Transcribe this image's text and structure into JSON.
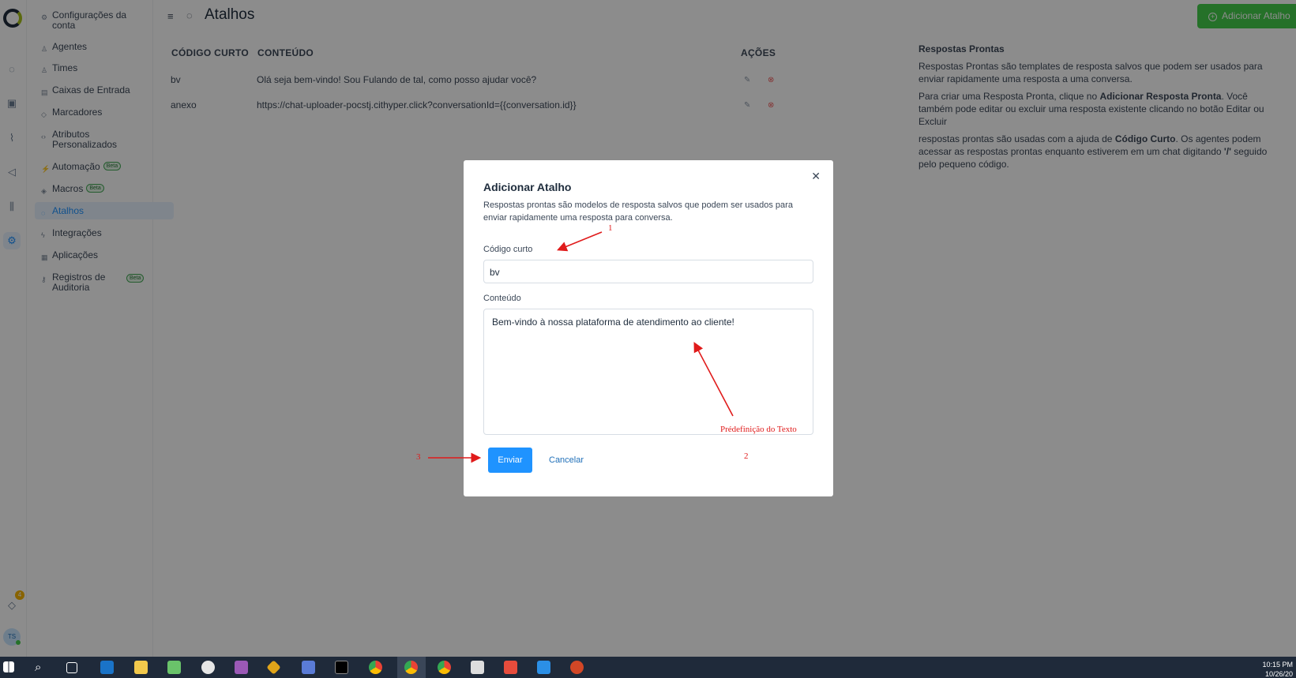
{
  "header": {
    "title": "Atalhos",
    "add_button": "Adicionar Atalho"
  },
  "sidebar": {
    "items": [
      {
        "label": "Configurações da conta",
        "icon": "gear-icon"
      },
      {
        "label": "Agentes",
        "icon": "people-icon"
      },
      {
        "label": "Times",
        "icon": "team-icon"
      },
      {
        "label": "Caixas de Entrada",
        "icon": "inbox-icon"
      },
      {
        "label": "Marcadores",
        "icon": "tag-icon"
      },
      {
        "label": "Atributos Personalizados",
        "icon": "code-icon"
      },
      {
        "label": "Automação",
        "icon": "automation-icon",
        "badge": "Beta"
      },
      {
        "label": "Macros",
        "icon": "macro-icon",
        "badge": "Beta"
      },
      {
        "label": "Atalhos",
        "icon": "chat-icon"
      },
      {
        "label": "Integrações",
        "icon": "plug-icon"
      },
      {
        "label": "Aplicações",
        "icon": "apps-icon"
      },
      {
        "label": "Registros de Auditoria",
        "icon": "key-icon",
        "badge": "Beta"
      }
    ]
  },
  "table": {
    "headers": [
      "CÓDIGO CURTO",
      "CONTEÚDO",
      "AÇÕES"
    ],
    "rows": [
      {
        "code": "bv",
        "content": "Olá seja bem-vindo! Sou Fulando de tal, como posso ajudar você?"
      },
      {
        "code": "anexo",
        "content": "https://chat-uploader-pocstj.cithyper.click?conversationId={{conversation.id}}"
      }
    ]
  },
  "info": {
    "title": "Respostas Prontas",
    "p1": "Respostas Prontas são templates de resposta salvos que podem ser usados para enviar rapidamente uma resposta a uma conversa.",
    "p2_a": "Para criar uma Resposta Pronta, clique no ",
    "p2_b": "Adicionar Resposta Pronta",
    "p2_c": ". Você também pode editar ou excluir uma resposta existente clicando no botão Editar ou Excluir",
    "p3_a": "respostas prontas são usadas com a ajuda de ",
    "p3_b": "Código Curto",
    "p3_c": ". Os agentes podem acessar as respostas prontas enquanto estiverem em um chat digitando ",
    "p3_d": "'/'",
    "p3_e": " seguido pelo pequeno código."
  },
  "modal": {
    "title": "Adicionar Atalho",
    "description": "Respostas prontas são modelos de resposta salvos que podem ser usados para enviar rapidamente uma resposta para conversa.",
    "code_label": "Código curto",
    "code_value": "bv",
    "content_label": "Conteúdo",
    "content_value": "Bem-vindo à nossa plataforma de atendimento ao cliente!",
    "submit": "Enviar",
    "cancel": "Cancelar"
  },
  "annotations": {
    "one": "1",
    "two": "2",
    "three": "3",
    "predef": "Prédefinição do Texto"
  },
  "rail": {
    "notification_count": "4",
    "avatar_initials": "TS"
  },
  "taskbar": {
    "time": "10:15 PM",
    "date": "10/26/20"
  },
  "colors": {
    "primary": "#1f93ff",
    "success": "#44ce4b",
    "danger": "#f05c5c",
    "annotation": "#e01b1b"
  }
}
